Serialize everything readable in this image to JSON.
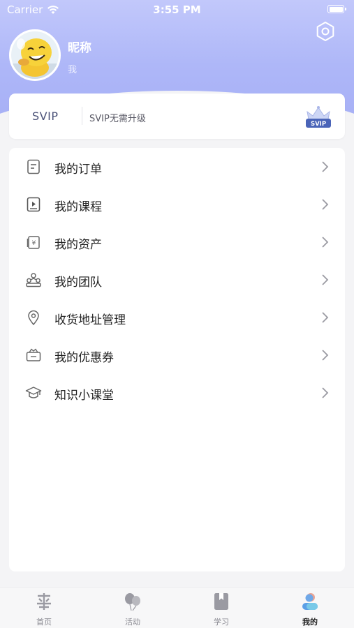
{
  "status_bar": {
    "carrier": "Carrier",
    "time": "3:55 PM"
  },
  "profile": {
    "nickname": "昵称",
    "subtitle": "我"
  },
  "svip": {
    "title": "SVIP",
    "description": "SVIP无需升级",
    "badge_text": "SVIP"
  },
  "menu": {
    "items": [
      {
        "label": "我的订单",
        "icon": "order-icon"
      },
      {
        "label": "我的课程",
        "icon": "course-icon"
      },
      {
        "label": "我的资产",
        "icon": "assets-icon"
      },
      {
        "label": "我的团队",
        "icon": "team-icon"
      },
      {
        "label": "收货地址管理",
        "icon": "location-icon"
      },
      {
        "label": "我的优惠券",
        "icon": "coupon-icon"
      },
      {
        "label": "知识小课堂",
        "icon": "graduation-cap-icon"
      }
    ]
  },
  "tab_bar": {
    "tabs": [
      {
        "label": "首页",
        "icon": "home-icon"
      },
      {
        "label": "活动",
        "icon": "balloons-icon"
      },
      {
        "label": "学习",
        "icon": "book-icon"
      },
      {
        "label": "我的",
        "icon": "profile-icon",
        "active": true
      }
    ]
  },
  "colors": {
    "header_gradient_top": "#c2c8fb",
    "header_gradient_bottom": "#a7b0f6",
    "svip_text": "#4b5278"
  }
}
